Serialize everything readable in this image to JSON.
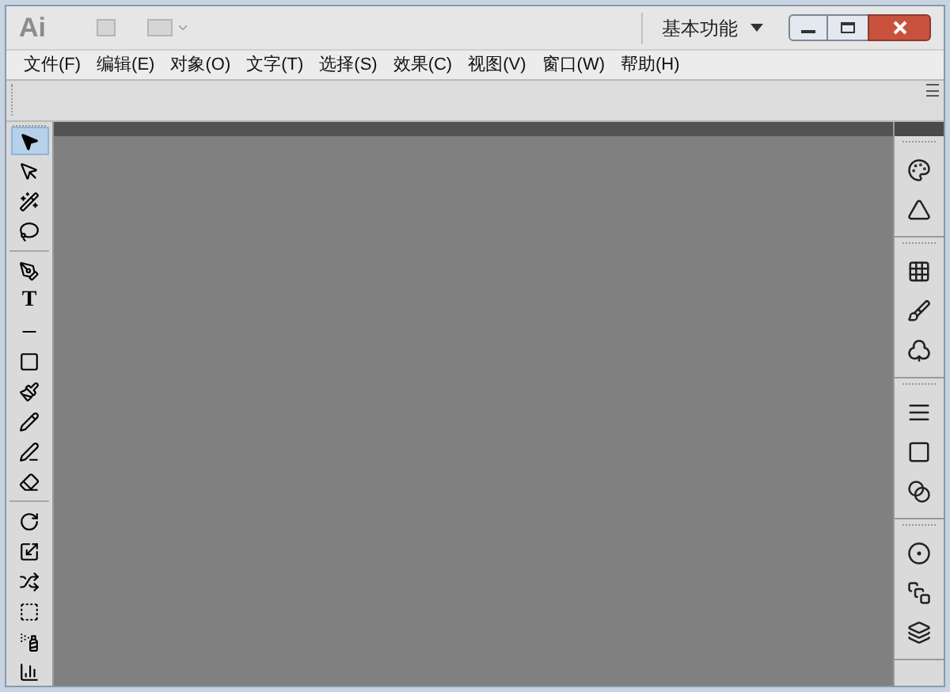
{
  "title_bar": {
    "logo": "Ai",
    "workspace": "基本功能"
  },
  "menu": [
    {
      "label": "文件(F)"
    },
    {
      "label": "编辑(E)"
    },
    {
      "label": "对象(O)"
    },
    {
      "label": "文字(T)"
    },
    {
      "label": "选择(S)"
    },
    {
      "label": "效果(C)"
    },
    {
      "label": "视图(V)"
    },
    {
      "label": "窗口(W)"
    },
    {
      "label": "帮助(H)"
    }
  ],
  "tools": [
    {
      "kind": "icon",
      "selected": true
    },
    {
      "kind": "icon",
      "selected": false
    },
    {
      "kind": "icon",
      "selected": false
    },
    {
      "kind": "icon",
      "selected": false
    },
    {
      "kind": "divider"
    },
    {
      "kind": "icon",
      "selected": false
    },
    {
      "kind": "text",
      "glyph": "T",
      "selected": false
    },
    {
      "kind": "icon",
      "selected": false
    },
    {
      "kind": "icon",
      "selected": false
    },
    {
      "kind": "icon",
      "selected": false
    },
    {
      "kind": "icon",
      "selected": false
    },
    {
      "kind": "icon",
      "selected": false
    },
    {
      "kind": "icon",
      "selected": false
    },
    {
      "kind": "divider"
    },
    {
      "kind": "icon",
      "selected": false
    },
    {
      "kind": "icon",
      "selected": false
    },
    {
      "kind": "icon",
      "selected": false
    },
    {
      "kind": "icon",
      "selected": false
    },
    {
      "kind": "icon",
      "selected": false
    },
    {
      "kind": "icon",
      "selected": false
    }
  ]
}
